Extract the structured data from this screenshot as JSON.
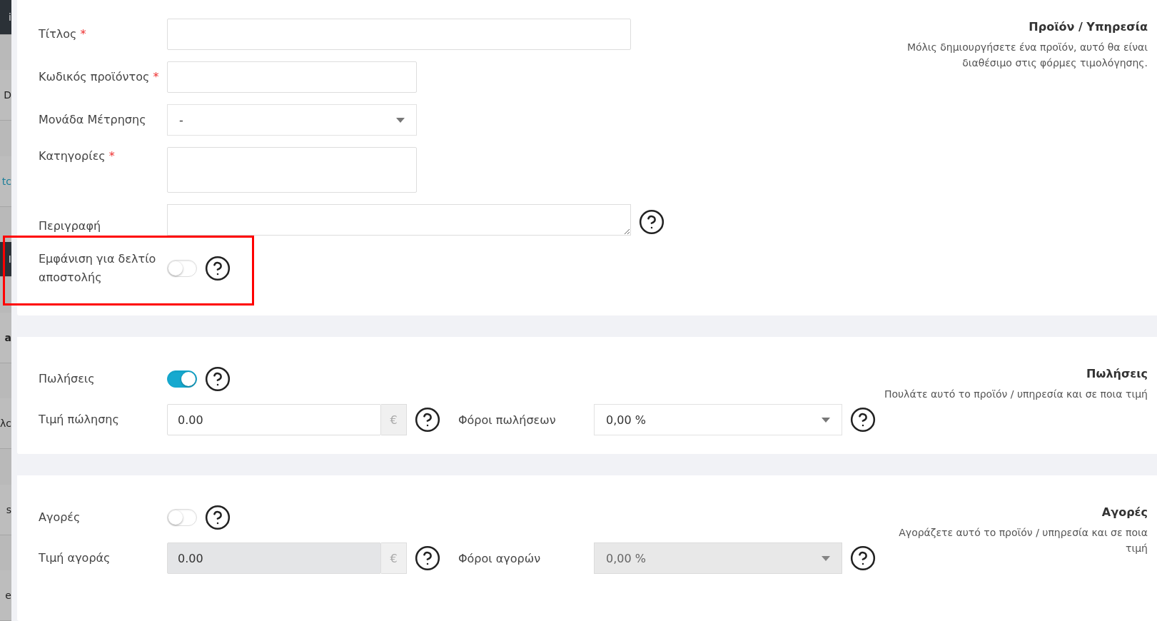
{
  "sidebar_fragments": [
    {
      "text": "i",
      "kind": "dark"
    },
    {
      "text": "D",
      "kind": "plain"
    },
    {
      "text": "tc",
      "kind": "link"
    },
    {
      "text": "I",
      "kind": "dark"
    },
    {
      "text": "a",
      "kind": "bold"
    },
    {
      "text": "λc",
      "kind": "plain"
    },
    {
      "text": "s",
      "kind": "plain"
    },
    {
      "text": "e",
      "kind": "plain"
    }
  ],
  "product": {
    "title": "Προϊόν / Υπηρεσία",
    "description": "Μόλις δημιουργήσετε ένα προϊόν, αυτό θα είναι διαθέσιμο στις φόρμες τιμολόγησης.",
    "fields": [
      {
        "kind": "wide_text",
        "label": "Τίτλος",
        "required_mark": "*"
      },
      {
        "kind": "text",
        "label": "Κωδικός προϊόντος",
        "required_mark": "*"
      },
      {
        "kind": "select",
        "label": "Μονάδα Μέτρησης",
        "value": "-"
      },
      {
        "kind": "tags",
        "label": "Κατηγορίες",
        "required_mark": "*"
      },
      {
        "kind": "textarea",
        "label": "Περιγραφή"
      },
      {
        "kind": "toggle",
        "label": "Εμφάνιση για δελτίο αποστολής",
        "on": false
      }
    ]
  },
  "sections": [
    {
      "title": "Πωλήσεις",
      "description": "Πουλάτε αυτό το προϊόν / υπηρεσία και σε ποια τιμή",
      "toggle": {
        "label": "Πωλήσεις",
        "on": true
      },
      "price": {
        "label": "Τιμή πώλησης",
        "value": "0.00",
        "currency": "€",
        "disabled": false
      },
      "tax": {
        "label": "Φόροι πωλήσεων",
        "value": "0,00 %",
        "disabled": false
      }
    },
    {
      "title": "Αγορές",
      "description": "Αγοράζετε αυτό το προϊόν / υπηρεσία και σε ποια τιμή",
      "toggle": {
        "label": "Αγορές",
        "on": false
      },
      "price": {
        "label": "Τιμή αγοράς",
        "value": "0.00",
        "currency": "€",
        "disabled": true
      },
      "tax": {
        "label": "Φόροι αγορών",
        "value": "0,00 %",
        "disabled": true
      }
    }
  ]
}
